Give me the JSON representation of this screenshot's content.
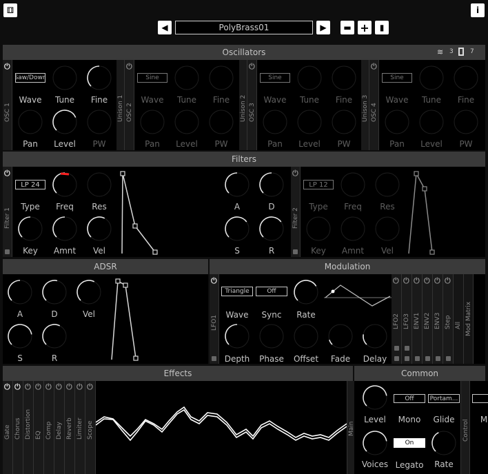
{
  "top": {
    "preset_name": "PolyBrass01"
  },
  "oscillators": {
    "title": "Oscillators",
    "layers_count": "3",
    "voices_count": "7",
    "blocks": [
      {
        "side": "OSC 1",
        "wave": "Saw/Down",
        "active": true,
        "labels": [
          "Wave",
          "Tune",
          "Fine",
          "Pan",
          "Level",
          "PW"
        ]
      },
      {
        "side": "OSC 2",
        "wave": "Sine",
        "active": false,
        "unison": "Unison 1",
        "labels": [
          "Wave",
          "Tune",
          "Fine",
          "Pan",
          "Level",
          "PW"
        ]
      },
      {
        "side": "OSC 3",
        "wave": "Sine",
        "active": false,
        "unison": "Unison 2",
        "labels": [
          "Wave",
          "Tune",
          "Fine",
          "Pan",
          "Level",
          "PW"
        ]
      },
      {
        "side": "OSC 4",
        "wave": "Sine",
        "active": false,
        "unison": "Unison 3",
        "labels": [
          "Wave",
          "Tune",
          "Fine",
          "Pan",
          "Level",
          "PW"
        ]
      }
    ]
  },
  "filters": {
    "title": "Filters",
    "f1": {
      "side": "Filter 1",
      "type": "LP 24",
      "labels": [
        "Type",
        "Freq",
        "Res",
        "Key",
        "Amnt",
        "Vel"
      ],
      "env_labels": [
        "A",
        "D",
        "S",
        "R"
      ]
    },
    "f2": {
      "side": "Filter 2",
      "type": "LP 12",
      "labels": [
        "Type",
        "Freq",
        "Res",
        "Key",
        "Amnt",
        "Vel"
      ]
    }
  },
  "adsr": {
    "title": "ADSR",
    "labels": [
      "A",
      "D",
      "Vel",
      "S",
      "R"
    ]
  },
  "modulation": {
    "title": "Modulation",
    "side": "LFO1",
    "wave": "Triangle",
    "sync": "Off",
    "labels": [
      "Wave",
      "Sync",
      "Rate",
      "Depth",
      "Phase",
      "Offset",
      "Fade",
      "Delay"
    ],
    "tabs": [
      "LFO2",
      "LFO3",
      "ENV1",
      "ENV2",
      "ENV3",
      "Step",
      "All",
      "Mod Matrix"
    ]
  },
  "effects": {
    "title": "Effects",
    "tabs": [
      "Gate",
      "Chorus",
      "Distortion",
      "EQ",
      "Comp",
      "Delay",
      "Reverb",
      "Limiter",
      "Scope"
    ],
    "main_tab": "Main"
  },
  "common": {
    "title": "Common",
    "mono": "Off",
    "glide": "Portam...",
    "legato": "On",
    "labels": [
      "Level",
      "Mono",
      "Glide",
      "Voices",
      "Legato",
      "Rate"
    ],
    "control_tab": "Control",
    "cut": "M"
  },
  "colors": {
    "accent": "#ff2020",
    "header": "#3a3a3a",
    "panel": "#000000"
  }
}
